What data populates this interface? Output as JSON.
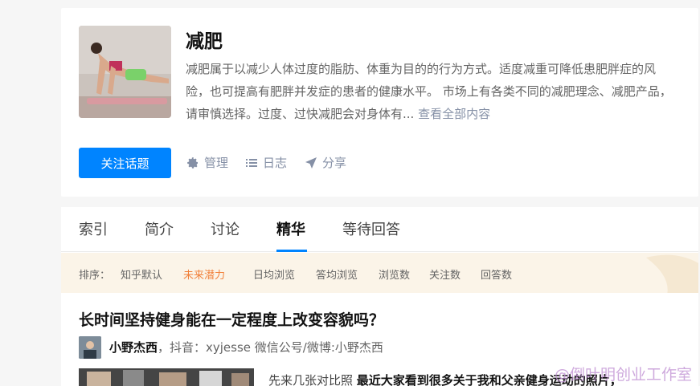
{
  "topic": {
    "title": "减肥",
    "description": "减肥属于以减少人体过度的脂肪、体重为目的的行为方式。适度减重可降低患肥胖症的风险，也可提高有肥胖并发症的患者的健康水平。 市场上有各类不同的减肥理念、减肥产品，请审慎选择。过度、过快减肥会对身体有...",
    "view_all": "查看全部内容",
    "follow_label": "关注话题",
    "actions": {
      "manage": "管理",
      "log": "日志",
      "share": "分享"
    }
  },
  "tabs": [
    "索引",
    "简介",
    "讨论",
    "精华",
    "等待回答"
  ],
  "active_tab": "精华",
  "sort": {
    "label": "排序：",
    "options": [
      "知乎默认",
      "未来潜力",
      "日均浏览",
      "答均浏览",
      "浏览数",
      "关注数",
      "回答数"
    ],
    "active": "未来潜力"
  },
  "question": {
    "title": "长时间坚持健身能在一定程度上改变容貌吗？",
    "author_name": "小野杰西",
    "author_bio": "，抖音：xyjesse 微信公号/微博:小野杰西",
    "excerpt_lead": "先来几张对比照 ",
    "excerpt_bold": "最近大家看到很多关于我和父亲健身运动的照片，"
  },
  "watermark": "@倒叶明创业工作室",
  "colors": {
    "accent": "#0084ff",
    "sort_active": "#f1803a",
    "sort_bg": "#fbf4e8"
  }
}
